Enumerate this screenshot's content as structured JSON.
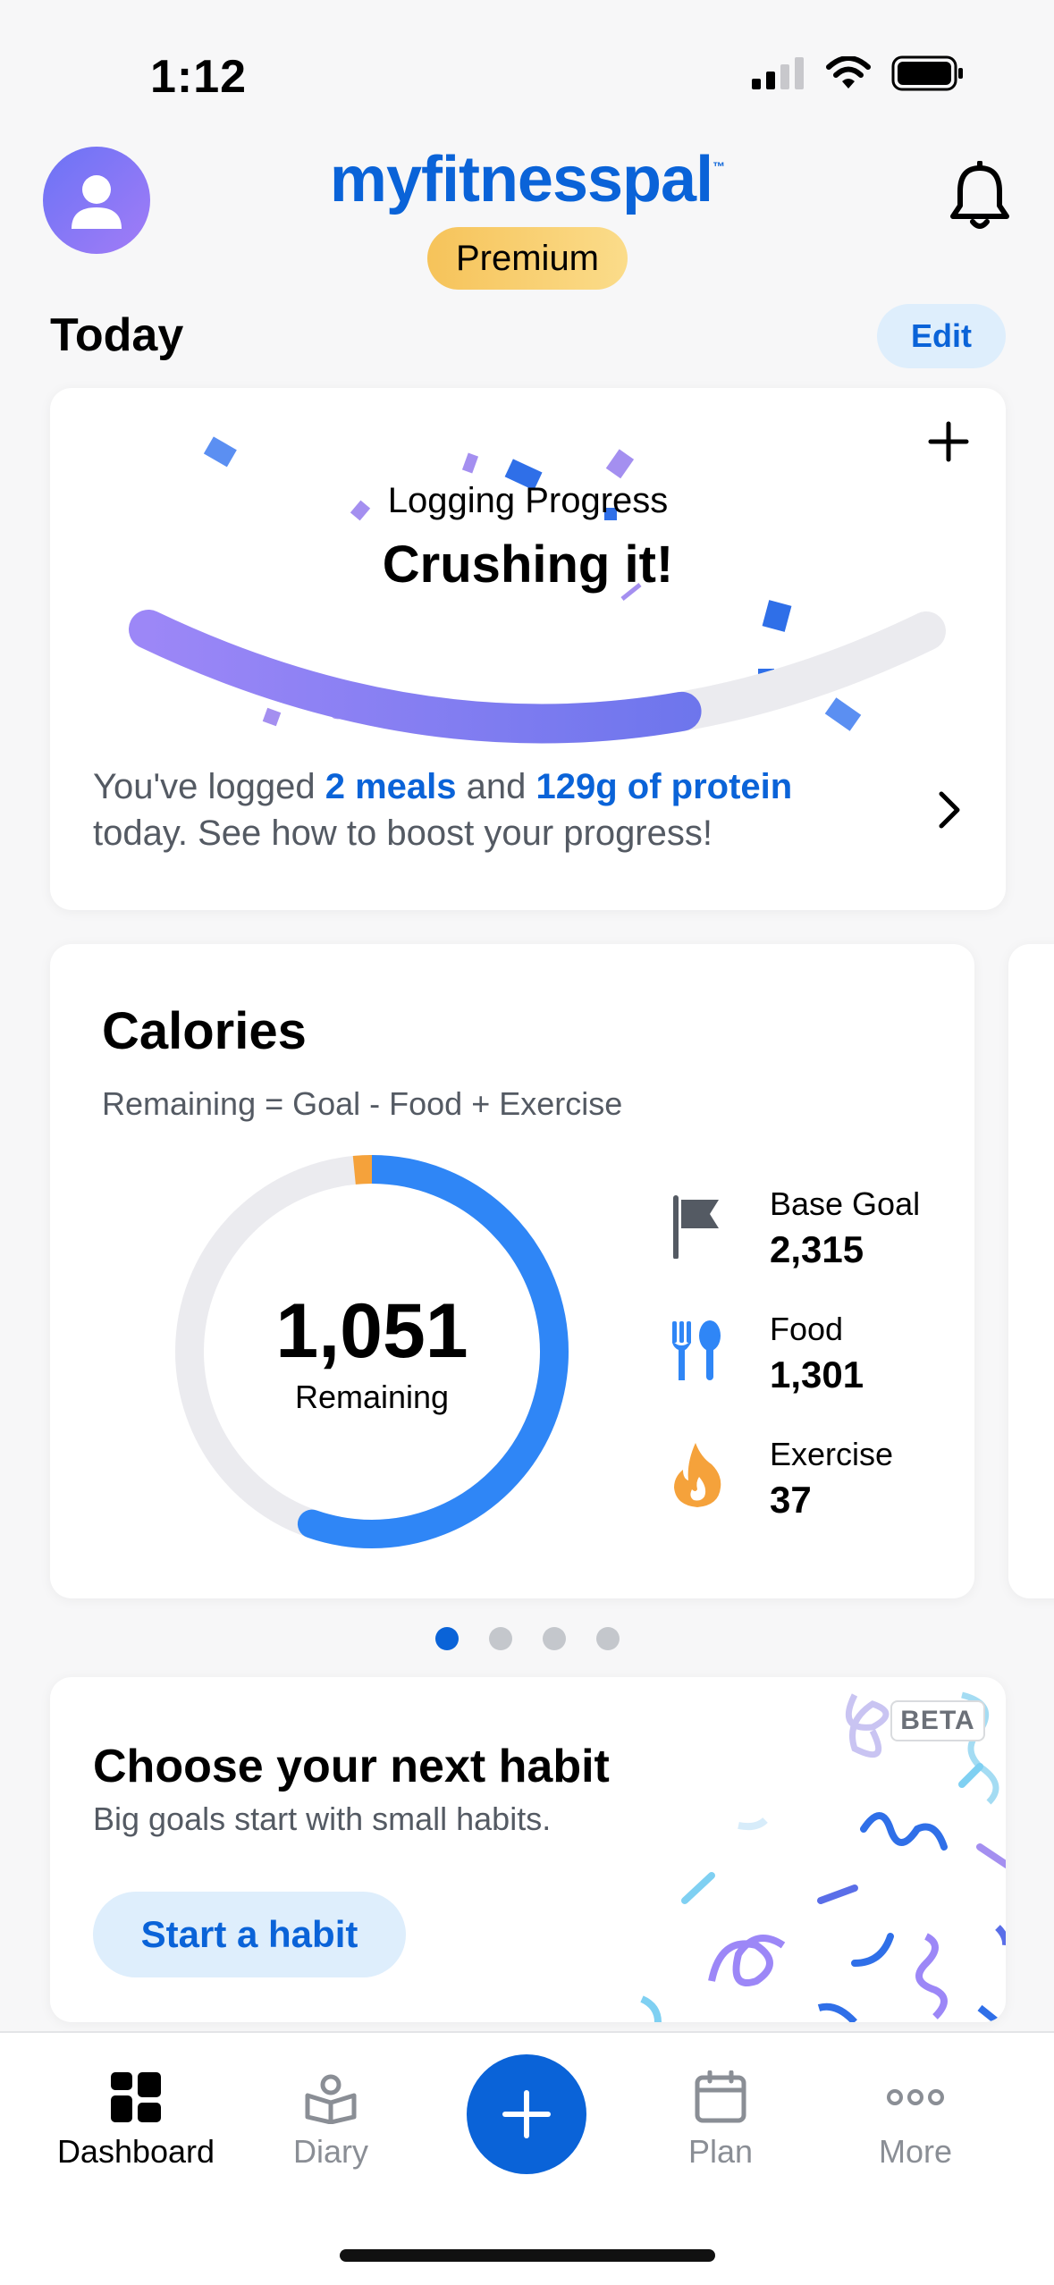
{
  "status_bar": {
    "time": "1:12"
  },
  "header": {
    "brand": "myfitnesspal",
    "brand_tm": "™",
    "badge": "Premium"
  },
  "section": {
    "title": "Today",
    "edit_label": "Edit"
  },
  "logging_progress": {
    "label": "Logging Progress",
    "title": "Crushing it!",
    "progress_fraction": 0.68,
    "text_prefix": "You've logged ",
    "meals": "2 meals",
    "text_mid": " and ",
    "protein": "129g of protein",
    "text_suffix": "today. See how to boost your progress!"
  },
  "calories": {
    "title": "Calories",
    "subtitle": "Remaining = Goal - Food + Exercise",
    "remaining_value": "1,051",
    "remaining_label": "Remaining",
    "stats": [
      {
        "label": "Base Goal",
        "value": "2,315",
        "icon": "flag-icon"
      },
      {
        "label": "Food",
        "value": "1,301",
        "icon": "fork-spoon-icon"
      },
      {
        "label": "Exercise",
        "value": "37",
        "icon": "flame-icon"
      }
    ],
    "colors": {
      "food": "#2f86f6",
      "exercise": "#f5a23b",
      "track": "#ebebef"
    }
  },
  "pager": {
    "count": 4,
    "active_index": 0
  },
  "habit": {
    "title": "Choose your next habit",
    "subtitle": "Big goals start with small habits.",
    "button": "Start a habit",
    "badge": "BETA"
  },
  "tabbar": {
    "items": [
      {
        "label": "Dashboard",
        "icon": "dashboard-icon",
        "active": true
      },
      {
        "label": "Diary",
        "icon": "diary-icon",
        "active": false
      },
      {
        "label": "Plan",
        "icon": "calendar-icon",
        "active": false
      },
      {
        "label": "More",
        "icon": "more-icon",
        "active": false
      }
    ]
  },
  "colors": {
    "brand": "#0a63d8",
    "accent_light": "#deeefc",
    "premium": "#f6c35a"
  }
}
